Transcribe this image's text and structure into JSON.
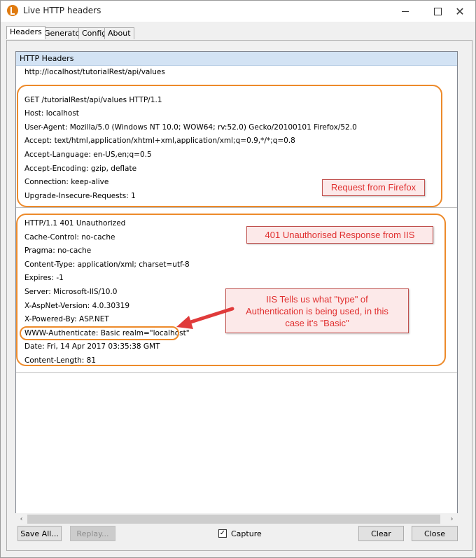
{
  "window": {
    "title": "Live HTTP headers",
    "icon": "app-icon",
    "controls": {
      "minimize": "minimize-icon",
      "maximize": "maximize-icon",
      "close": "✕"
    }
  },
  "tabs": [
    {
      "label": "Headers",
      "active": true
    },
    {
      "label": "Generator",
      "active": false
    },
    {
      "label": "Config",
      "active": false
    },
    {
      "label": "About",
      "active": false
    }
  ],
  "list": {
    "header": "HTTP Headers",
    "url": "http://localhost/tutorialRest/api/values",
    "request": [
      "GET /tutorialRest/api/values HTTP/1.1",
      "Host: localhost",
      "User-Agent: Mozilla/5.0 (Windows NT 10.0; WOW64; rv:52.0) Gecko/20100101 Firefox/52.0",
      "Accept: text/html,application/xhtml+xml,application/xml;q=0.9,*/*;q=0.8",
      "Accept-Language: en-US,en;q=0.5",
      "Accept-Encoding: gzip, deflate",
      "Connection: keep-alive",
      "Upgrade-Insecure-Requests: 1"
    ],
    "response": [
      "HTTP/1.1 401 Unauthorized",
      "Cache-Control: no-cache",
      "Pragma: no-cache",
      "Content-Type: application/xml; charset=utf-8",
      "Expires: -1",
      "Server: Microsoft-IIS/10.0",
      "X-AspNet-Version: 4.0.30319",
      "X-Powered-By: ASP.NET",
      "WWW-Authenticate: Basic realm=\"localhost\"",
      "Date: Fri, 14 Apr 2017 03:35:38 GMT",
      "Content-Length: 81"
    ]
  },
  "annotations": {
    "request_label": "Request from Firefox",
    "response_label": "401 Unauthorised Response from IIS",
    "auth_note_line1": "IIS Tells us what \"type\" of",
    "auth_note_line2": "Authentication is being used, in this",
    "auth_note_line3": "case it's \"Basic\"",
    "color": "#ed8a2a",
    "arrow_color": "#e03b3b"
  },
  "scrollbar": {
    "left_arrow": "‹",
    "right_arrow": "›"
  },
  "buttons": {
    "save_all": "Save All...",
    "replay": "Replay...",
    "capture": "Capture",
    "capture_checked": true,
    "clear": "Clear",
    "close": "Close"
  }
}
